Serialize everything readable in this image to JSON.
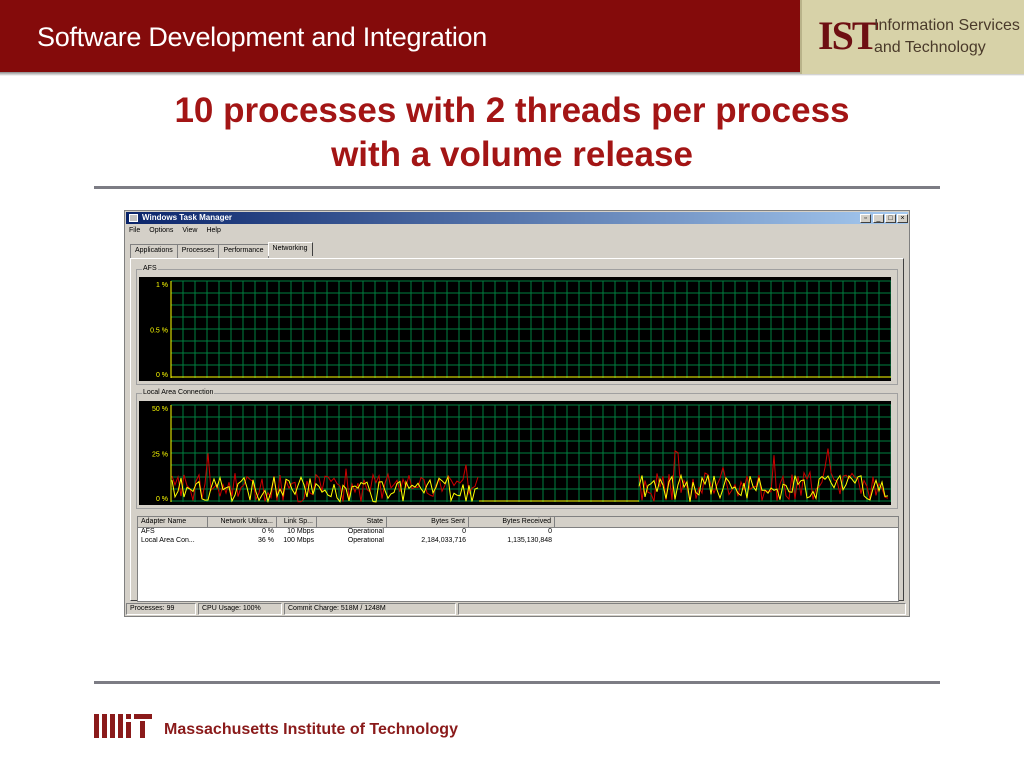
{
  "header": {
    "title": "Software Development and Integration"
  },
  "ist": {
    "logo": "IST",
    "line1": "Information Services",
    "line2": "and Technology"
  },
  "slide": {
    "title_line1": "10 processes with 2 threads per process",
    "title_line2": "with a volume release"
  },
  "window": {
    "title": "Windows Task Manager",
    "menu": [
      "File",
      "Options",
      "View",
      "Help"
    ],
    "tabs": [
      "Applications",
      "Processes",
      "Performance",
      "Networking"
    ],
    "active_tab": "Networking",
    "graphs": [
      {
        "label": "AFS",
        "ticks": [
          "1 %",
          "0.5 %",
          "0 %"
        ]
      },
      {
        "label": "Local Area Connection",
        "ticks": [
          "50 %",
          "25 %",
          "0 %"
        ]
      }
    ],
    "columns": [
      "Adapter Name",
      "Network Utiliza...",
      "Link Sp...",
      "State",
      "Bytes Sent",
      "Bytes Received"
    ],
    "rows": [
      [
        "AFS",
        "0 %",
        "10 Mbps",
        "Operational",
        "0",
        "0"
      ],
      [
        "Local Area Con...",
        "36 %",
        "100 Mbps",
        "Operational",
        "2,184,033,716",
        "1,135,130,848"
      ]
    ],
    "status": {
      "processes": "Processes: 99",
      "cpu": "CPU Usage: 100%",
      "commit": "Commit Charge: 518M / 1248M"
    }
  },
  "footer": {
    "org": "Massachusetts Institute of Technology"
  },
  "colors": {
    "header_red": "#840b0b",
    "title_red": "#a31515",
    "graph_grid": "#008040",
    "series_red": "#cc0000",
    "series_yellow": "#ffff00"
  }
}
